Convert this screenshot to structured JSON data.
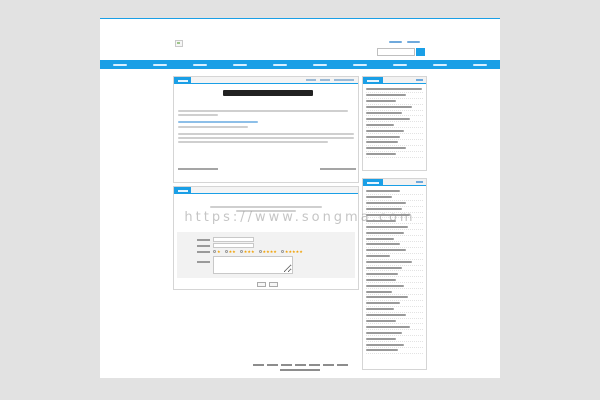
{
  "header": {
    "links": [
      "",
      ""
    ],
    "search": {
      "placeholder": "",
      "button_label": ""
    }
  },
  "nav": {
    "items": [
      "",
      "",
      "",
      "",
      "",
      "",
      "",
      "",
      "",
      ""
    ]
  },
  "watermark": "https://www.songma.com",
  "article": {
    "tab_label": "",
    "breadcrumb": [
      "",
      "",
      ""
    ],
    "title": "",
    "paragraphs": [
      "",
      "",
      "",
      ""
    ],
    "prev": "",
    "next": ""
  },
  "comment": {
    "tab_label": "",
    "notice": "",
    "fields": {
      "name_label": "",
      "email_label": "",
      "rating_label": "",
      "content_label": ""
    },
    "rating_options": [
      "",
      "",
      "",
      "",
      ""
    ],
    "submit_label": "",
    "reset_label": ""
  },
  "sidebar": {
    "latest": {
      "title": "",
      "more": "",
      "items": [
        "",
        "",
        "",
        "",
        "",
        "",
        "",
        "",
        "",
        "",
        "",
        ""
      ]
    },
    "recommended": {
      "title": "",
      "more": "",
      "items": [
        "",
        "",
        "",
        "",
        "",
        "",
        "",
        "",
        "",
        "",
        "",
        "",
        "",
        "",
        "",
        "",
        "",
        "",
        "",
        "",
        "",
        "",
        "",
        "",
        "",
        "",
        "",
        ""
      ]
    }
  },
  "footer": {
    "links": [
      "",
      "",
      "",
      "",
      "",
      "",
      ""
    ],
    "copyright": ""
  },
  "colors": {
    "accent": "#1a9fe6",
    "background": "#e2e2e2",
    "panel": "#ffffff",
    "star": "#f0a000"
  }
}
